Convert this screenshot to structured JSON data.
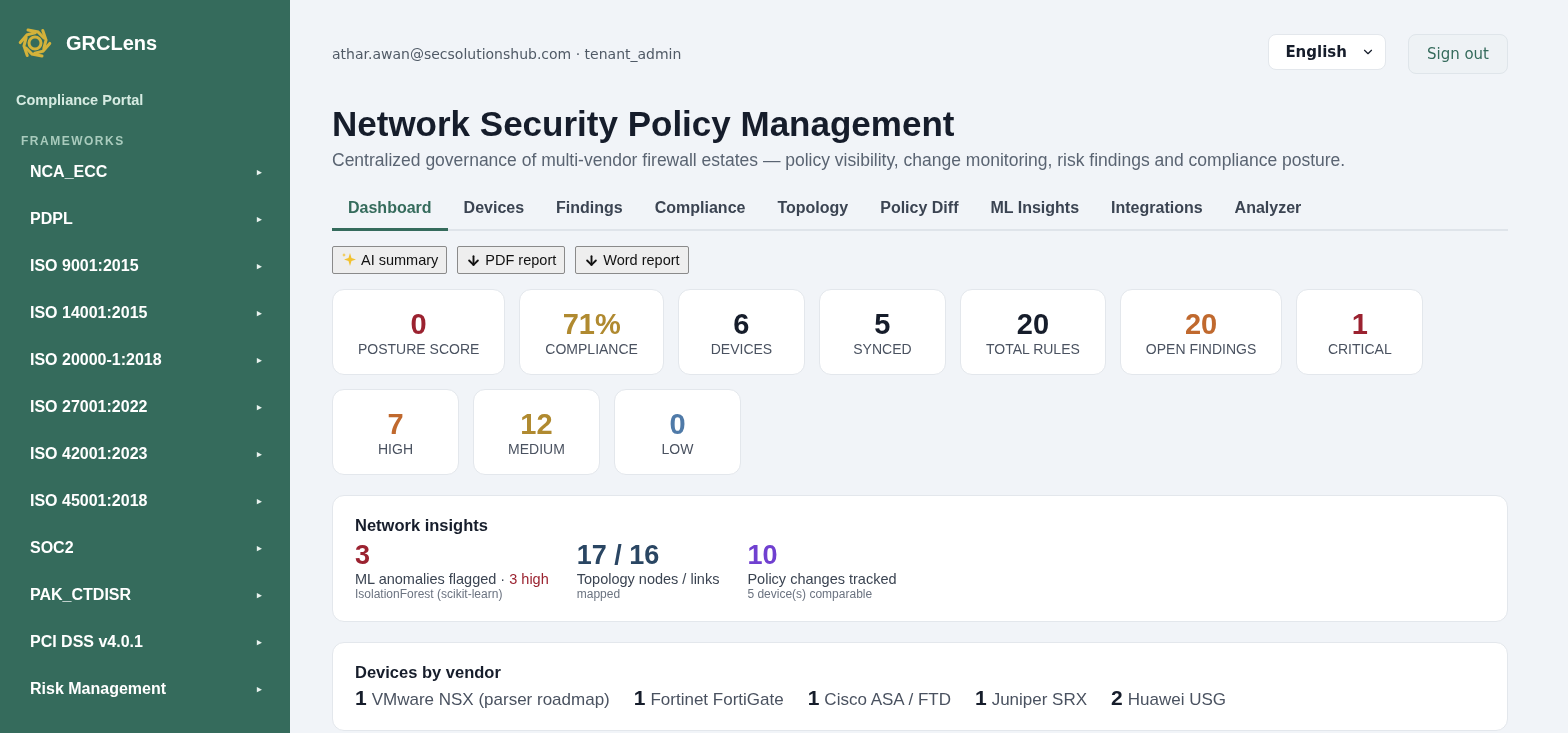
{
  "brand": {
    "name": "GRCLens",
    "subtitle": "Compliance Portal"
  },
  "sidebar": {
    "section": "FRAMEWORKS",
    "items": [
      {
        "label": "NCA_ECC",
        "arrow": "▸"
      },
      {
        "label": "PDPL",
        "arrow": "▸"
      },
      {
        "label": "ISO 9001:2015",
        "arrow": "▸"
      },
      {
        "label": "ISO 14001:2015",
        "arrow": "▸"
      },
      {
        "label": "ISO 20000-1:2018",
        "arrow": "▸"
      },
      {
        "label": "ISO 27001:2022",
        "arrow": "▸"
      },
      {
        "label": "ISO 42001:2023",
        "arrow": "▸"
      },
      {
        "label": "ISO 45001:2018",
        "arrow": "▸"
      },
      {
        "label": "SOC2",
        "arrow": "▸"
      },
      {
        "label": "PAK_CTDISR",
        "arrow": "▸"
      },
      {
        "label": "PCI DSS v4.0.1",
        "arrow": "▸"
      },
      {
        "label": "Risk Management",
        "arrow": "▸"
      }
    ]
  },
  "header": {
    "user": "athar.awan@secsolutionshub.com · tenant_admin",
    "language": "English",
    "sign_out": "Sign out"
  },
  "page": {
    "title": "Network Security Policy Management",
    "description": "Centralized governance of multi-vendor firewall estates — policy visibility, change monitoring, risk findings and compliance posture."
  },
  "tabs": [
    {
      "label": "Dashboard",
      "selected": true
    },
    {
      "label": "Devices",
      "selected": false
    },
    {
      "label": "Findings",
      "selected": false
    },
    {
      "label": "Compliance",
      "selected": false
    },
    {
      "label": "Topology",
      "selected": false
    },
    {
      "label": "Policy Diff",
      "selected": false
    },
    {
      "label": "ML Insights",
      "selected": false
    },
    {
      "label": "Integrations",
      "selected": false
    },
    {
      "label": "Analyzer",
      "selected": false
    }
  ],
  "actions": [
    {
      "kind": "sparkle",
      "label": "AI summary"
    },
    {
      "kind": "download",
      "label": "PDF report"
    },
    {
      "kind": "download",
      "label": "Word report"
    }
  ],
  "stats": [
    {
      "value": "0",
      "label": "POSTURE SCORE",
      "color": "#9b2230"
    },
    {
      "value": "71%",
      "label": "COMPLIANCE",
      "color": "#b08a30"
    },
    {
      "value": "6",
      "label": "DEVICES",
      "color": "#161d2b"
    },
    {
      "value": "5",
      "label": "SYNCED",
      "color": "#161d2b"
    },
    {
      "value": "20",
      "label": "TOTAL RULES",
      "color": "#161d2b"
    },
    {
      "value": "20",
      "label": "OPEN FINDINGS",
      "color": "#c0692e"
    },
    {
      "value": "1",
      "label": "CRITICAL",
      "color": "#9b2230"
    },
    {
      "value": "7",
      "label": "HIGH",
      "color": "#c0692e"
    },
    {
      "value": "12",
      "label": "MEDIUM",
      "color": "#b08a30"
    },
    {
      "value": "0",
      "label": "LOW",
      "color": "#4f7aa8"
    }
  ],
  "insights": {
    "title": "Network insights",
    "items": [
      {
        "value": "3",
        "label": "ML anomalies flagged",
        "separator": "·",
        "highlight": "3 high",
        "note": "IsolationForest (scikit-learn)",
        "color": "#9b2230"
      },
      {
        "value": "17 / 16",
        "label": "Topology nodes / links",
        "note": "mapped",
        "color": "#2a4663"
      },
      {
        "value": "10",
        "label": "Policy changes tracked",
        "note": "5 device(s) comparable",
        "color": "#7040d0"
      }
    ]
  },
  "vendors": {
    "title": "Devices by vendor",
    "items": [
      {
        "count": "1",
        "name": "VMware NSX (parser roadmap)"
      },
      {
        "count": "1",
        "name": "Fortinet FortiGate"
      },
      {
        "count": "1",
        "name": "Cisco ASA / FTD"
      },
      {
        "count": "1",
        "name": "Juniper SRX"
      },
      {
        "count": "2",
        "name": "Huawei USG"
      }
    ]
  }
}
